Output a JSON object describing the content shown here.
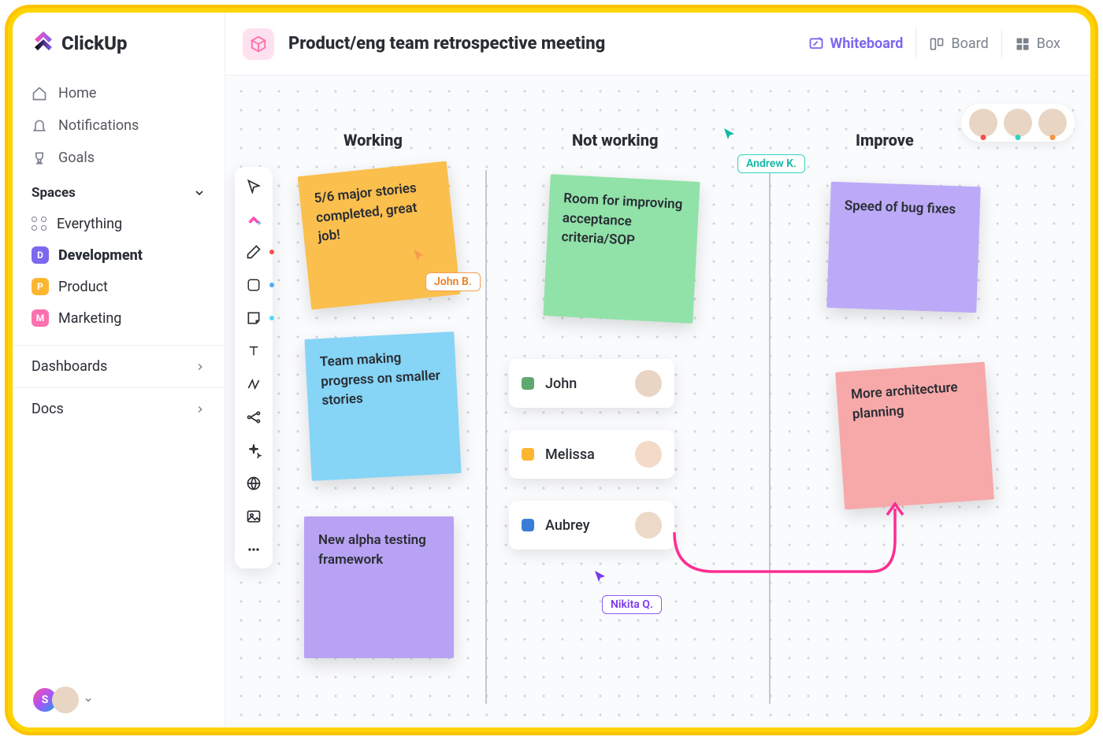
{
  "brand": "ClickUp",
  "nav": {
    "home": "Home",
    "notifications": "Notifications",
    "goals": "Goals"
  },
  "spaces": {
    "header": "Spaces",
    "everything": "Everything",
    "items": [
      {
        "letter": "D",
        "label": "Development",
        "color": "purple",
        "bold": true
      },
      {
        "letter": "P",
        "label": "Product",
        "color": "orange",
        "bold": false
      },
      {
        "letter": "M",
        "label": "Marketing",
        "color": "pink",
        "bold": false
      }
    ]
  },
  "sections": {
    "dashboards": "Dashboards",
    "docs": "Docs"
  },
  "user_badge": "S",
  "header": {
    "title": "Product/eng team retrospective meeting",
    "views": {
      "whiteboard": "Whiteboard",
      "board": "Board",
      "box": "Box"
    }
  },
  "columns": {
    "working": "Working",
    "not_working": "Not working",
    "improve": "Improve"
  },
  "stickies": {
    "s1": "5/6 major stories completed, great job!",
    "s2": "Team making progress on smaller stories",
    "s3": "New alpha testing framework",
    "s4": "Room for improving acceptance criteria/SOP",
    "s5": "Speed of bug fixes",
    "s6": "More architecture planning"
  },
  "people": {
    "p1": "John",
    "p2": "Melissa",
    "p3": "Aubrey"
  },
  "cursors": {
    "john": "John B.",
    "andrew": "Andrew K.",
    "nikita": "Nikita Q."
  }
}
